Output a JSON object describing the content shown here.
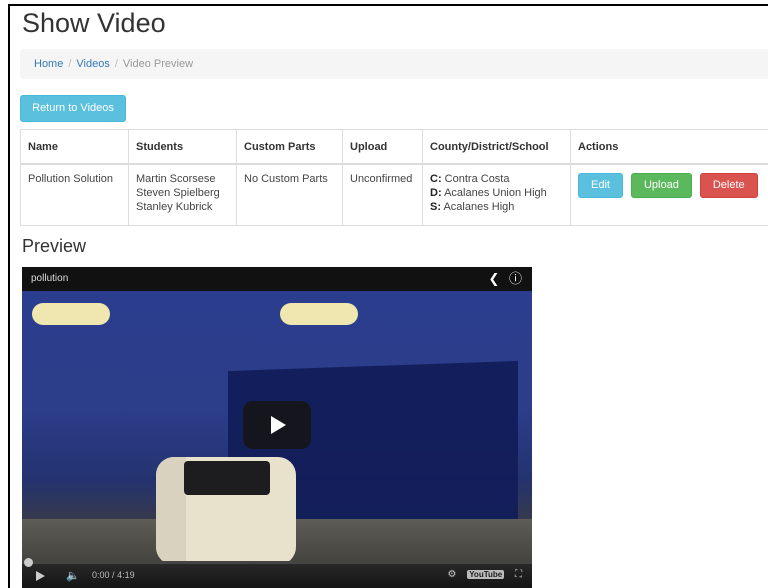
{
  "page": {
    "title": "Show Video"
  },
  "breadcrumb": {
    "home": "Home",
    "videos": "Videos",
    "current": "Video Preview",
    "separator": "/"
  },
  "return_button": "Return to Videos",
  "table": {
    "headers": [
      "Name",
      "Students",
      "Custom Parts",
      "Upload",
      "County/District/School",
      "Actions"
    ],
    "row": {
      "name": "Pollution Solution",
      "students": [
        "Martin Scorsese",
        "Steven Spielberg",
        "Stanley Kubrick"
      ],
      "custom_parts": "No Custom Parts",
      "upload": "Unconfirmed",
      "county_prefix": "C:",
      "county": "Contra Costa",
      "district_prefix": "D:",
      "district": "Acalanes Union High",
      "school_prefix": "S:",
      "school": "Acalanes High",
      "actions": {
        "edit": "Edit",
        "upload": "Upload",
        "delete": "Delete"
      }
    }
  },
  "preview": {
    "heading": "Preview",
    "video_title": "pollution",
    "time_current": "0:00",
    "time_separator": "/",
    "time_total": "4:19",
    "logo_text": "Tube",
    "logo_prefix": "You",
    "icons": [
      "share-icon",
      "info-icon",
      "play-icon",
      "volume-icon",
      "settings-icon",
      "fullscreen-icon"
    ]
  },
  "colors": {
    "info": "#5bc0de",
    "success": "#5cb85c",
    "danger": "#d9534f",
    "link": "#337ab7"
  }
}
